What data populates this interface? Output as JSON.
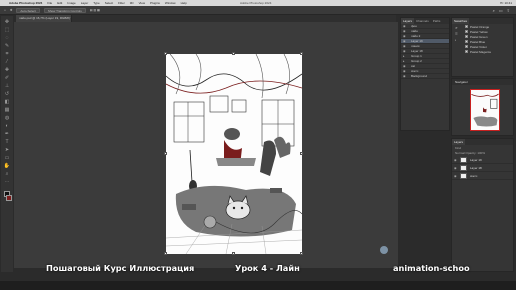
{
  "menubar": {
    "app_name": "Adobe Photoshop 2024",
    "items": [
      "File",
      "Edit",
      "Image",
      "Layer",
      "Type",
      "Select",
      "Filter",
      "3D",
      "View",
      "Plugins",
      "Window",
      "Help"
    ],
    "center_title": "Adobe Photoshop 2024",
    "clock": "Пт 10:41"
  },
  "options": {
    "auto_select": "Auto-Select",
    "show_transform": "Show Transform Controls"
  },
  "document": {
    "tab_title": "лайн.psd @ 16,7% (Layer 19, RGB/8) *"
  },
  "panels": {
    "left_tabs": [
      "Layers",
      "Channels",
      "Paths"
    ],
    "layers": [
      "фон",
      "лайн",
      "лайн 2",
      "Layer 19",
      "линии",
      "Layer 18",
      "Group 1",
      "Group 2",
      "cat",
      "скетч",
      "Background"
    ],
    "swatches_tab": "Swatches",
    "colors": [
      "Pastel Orange",
      "Pastel Yellow",
      "Pastel Green",
      "Pastel Blue",
      "Pastel Violet",
      "Pastel Magenta"
    ],
    "navigator": "Navigator",
    "lp_filter": "Kind",
    "lp_opts": "Normal   Opacity: 100%",
    "lp_rows": [
      "Layer 19",
      "Layer 18",
      "скетч"
    ]
  },
  "subtitles": {
    "left": "Пошаговый Курс Иллюстрация",
    "mid": "Урок 4 - Лайн",
    "right": "animation-schoo"
  },
  "colors": {
    "ui_bg": "#2b2b2b",
    "canvas_bg": "#3b3b3b",
    "artboard": "#fdfdfd",
    "accent_red": "#7a1d1d"
  }
}
